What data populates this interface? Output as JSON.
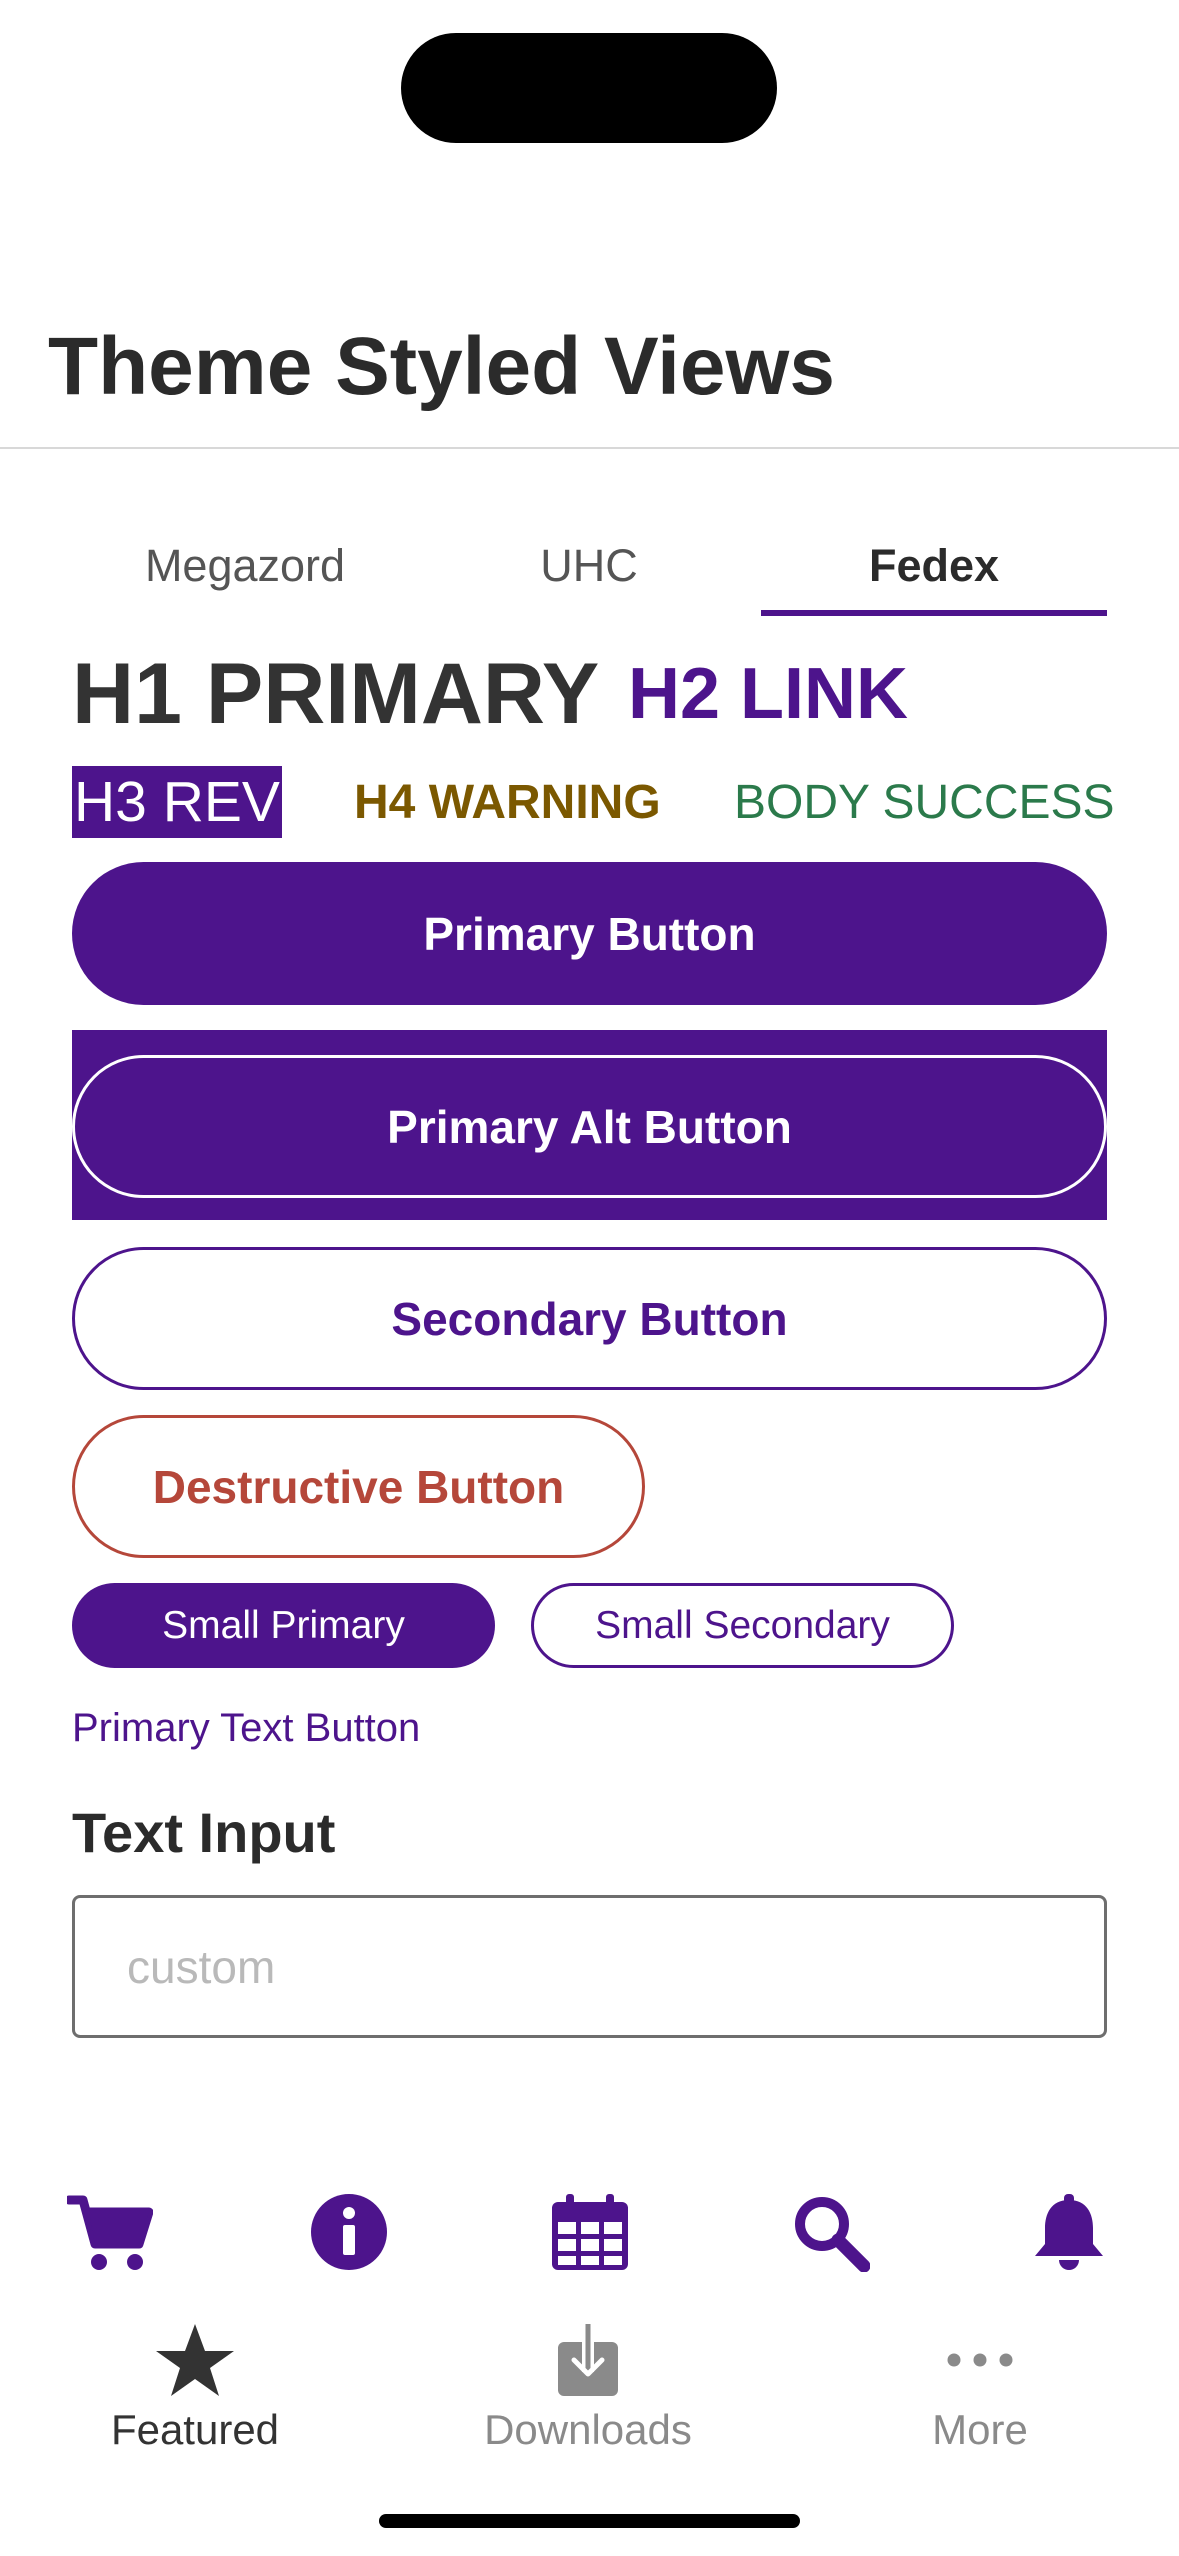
{
  "nav": {
    "title": "Theme Styled Views"
  },
  "tabs": [
    {
      "label": "Megazord",
      "selected": false
    },
    {
      "label": "UHC",
      "selected": false
    },
    {
      "label": "Fedex",
      "selected": true
    }
  ],
  "headings": {
    "h1": "H1 PRIMARY",
    "h2": "H2 LINK",
    "h3": "H3 REV",
    "h4": "H4 WARNING",
    "body": "BODY SUCCESS"
  },
  "buttons": {
    "primary": "Primary Button",
    "primary_alt": "Primary Alt Button",
    "secondary": "Secondary Button",
    "destructive": "Destructive Button",
    "small_primary": "Small Primary",
    "small_secondary": "Small Secondary",
    "text": "Primary Text Button"
  },
  "text_input": {
    "label": "Text Input",
    "value": "",
    "placeholder": "custom"
  },
  "icons": [
    "cart-icon",
    "info-icon",
    "calendar-icon",
    "search-icon",
    "bell-icon"
  ],
  "tabbar": [
    {
      "label": "Featured",
      "icon": "star-icon",
      "selected": true
    },
    {
      "label": "Downloads",
      "icon": "download-icon",
      "selected": false
    },
    {
      "label": "More",
      "icon": "ellipsis-icon",
      "selected": false
    }
  ],
  "colors": {
    "brand_purple": "#4d148c",
    "warning": "#7b5800",
    "success": "#2b7a4b",
    "destructive": "#b5473a",
    "text_dark": "#333333"
  }
}
